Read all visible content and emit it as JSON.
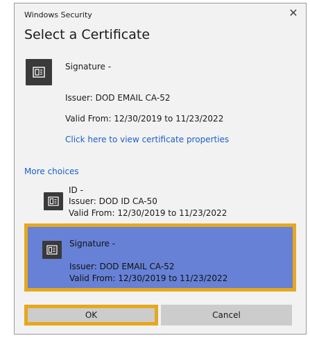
{
  "window": {
    "title": "Windows Security",
    "close_glyph": "✕"
  },
  "heading": "Select a Certificate",
  "selected_cert": {
    "icon": "certificate-icon",
    "name": "Signature -",
    "issuer": "Issuer: DOD EMAIL CA-52",
    "valid": "Valid From: 12/30/2019 to 11/23/2022",
    "properties_link": "Click here to view certificate properties"
  },
  "more_choices_label": "More choices",
  "choices": [
    {
      "icon": "certificate-icon",
      "name": "ID -",
      "issuer": "Issuer: DOD ID CA-50",
      "valid": "Valid From: 12/30/2019 to 11/23/2022",
      "selected": false
    },
    {
      "icon": "certificate-icon",
      "name": "Signature -",
      "issuer": "Issuer: DOD EMAIL CA-52",
      "valid": "Valid From: 12/30/2019 to 11/23/2022",
      "selected": true
    }
  ],
  "buttons": {
    "ok": "OK",
    "cancel": "Cancel"
  },
  "colors": {
    "highlight_border": "#e6a81c",
    "selected_bg": "#6681d6",
    "link": "#1a5fcc"
  }
}
